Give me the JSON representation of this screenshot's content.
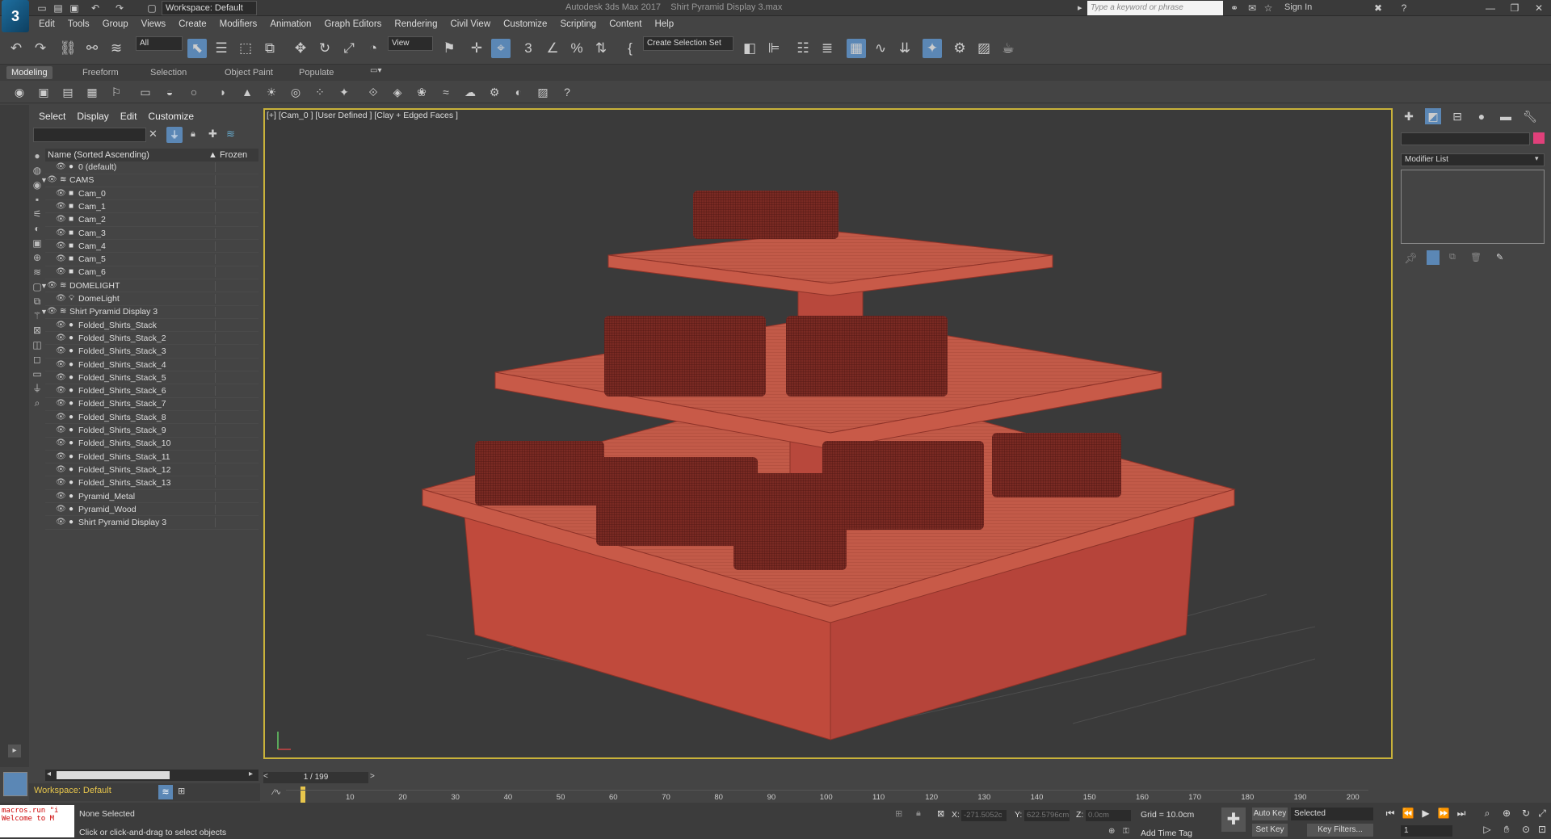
{
  "window": {
    "app_title": "Autodesk 3ds Max 2017",
    "file_title": "Shirt Pyramid Display 3.max",
    "workspace": "Workspace: Default",
    "search_placeholder": "Type a keyword or phrase",
    "sign_in": "Sign In"
  },
  "menu": [
    "Edit",
    "Tools",
    "Group",
    "Views",
    "Create",
    "Modifiers",
    "Animation",
    "Graph Editors",
    "Rendering",
    "Civil View",
    "Customize",
    "Scripting",
    "Content",
    "Help"
  ],
  "toolbar": {
    "filter": "All",
    "view": "View",
    "selection_set": "Create Selection Set"
  },
  "ribbon_tabs": [
    "Modeling",
    "Freeform",
    "Selection",
    "Object Paint",
    "Populate"
  ],
  "scene_explorer": {
    "tabs": [
      "Select",
      "Display",
      "Edit",
      "Customize"
    ],
    "col_name": "Name (Sorted Ascending)",
    "col_frozen": "▲ Frozen",
    "rows": [
      {
        "label": "0 (default)",
        "level": 1
      },
      {
        "label": "CAMS",
        "level": 0
      },
      {
        "label": "Cam_0",
        "level": 1
      },
      {
        "label": "Cam_1",
        "level": 1
      },
      {
        "label": "Cam_2",
        "level": 1
      },
      {
        "label": "Cam_3",
        "level": 1
      },
      {
        "label": "Cam_4",
        "level": 1
      },
      {
        "label": "Cam_5",
        "level": 1
      },
      {
        "label": "Cam_6",
        "level": 1
      },
      {
        "label": "DOMELIGHT",
        "level": 0
      },
      {
        "label": "DomeLight",
        "level": 1
      },
      {
        "label": "Shirt Pyramid Display 3",
        "level": 0
      },
      {
        "label": "Folded_Shirts_Stack",
        "level": 1
      },
      {
        "label": "Folded_Shirts_Stack_2",
        "level": 1
      },
      {
        "label": "Folded_Shirts_Stack_3",
        "level": 1
      },
      {
        "label": "Folded_Shirts_Stack_4",
        "level": 1
      },
      {
        "label": "Folded_Shirts_Stack_5",
        "level": 1
      },
      {
        "label": "Folded_Shirts_Stack_6",
        "level": 1
      },
      {
        "label": "Folded_Shirts_Stack_7",
        "level": 1
      },
      {
        "label": "Folded_Shirts_Stack_8",
        "level": 1
      },
      {
        "label": "Folded_Shirts_Stack_9",
        "level": 1
      },
      {
        "label": "Folded_Shirts_Stack_10",
        "level": 1
      },
      {
        "label": "Folded_Shirts_Stack_11",
        "level": 1
      },
      {
        "label": "Folded_Shirts_Stack_12",
        "level": 1
      },
      {
        "label": "Folded_Shirts_Stack_13",
        "level": 1
      },
      {
        "label": "Pyramid_Metal",
        "level": 1
      },
      {
        "label": "Pyramid_Wood",
        "level": 1
      },
      {
        "label": "Shirt Pyramid Display 3",
        "level": 1
      }
    ]
  },
  "viewport": {
    "label": "[+] [Cam_0 ] [User Defined ] [Clay + Edged Faces ]"
  },
  "command_panel": {
    "modifier_list": "Modifier List"
  },
  "timeline": {
    "slider": "1 / 199",
    "ticks": [
      "10",
      "20",
      "30",
      "40",
      "50",
      "60",
      "70",
      "80",
      "90",
      "100",
      "110",
      "120",
      "130",
      "140",
      "150",
      "160",
      "170",
      "180",
      "190",
      "200"
    ]
  },
  "status": {
    "maxscript": "macros.run \"i\nWelcome to M",
    "selection": "None Selected",
    "prompt": "Click or click-and-drag to select objects",
    "x_label": "X:",
    "x_value": "-271.5052c",
    "y_label": "Y:",
    "y_value": "622.5796cm",
    "z_label": "Z:",
    "z_value": "0.0cm",
    "grid": "Grid = 10.0cm",
    "add_time_tag": "Add Time Tag",
    "auto_key": "Auto Key",
    "set_key": "Set Key",
    "selected": "Selected",
    "key_filters": "Key Filters...",
    "frame": "1"
  }
}
